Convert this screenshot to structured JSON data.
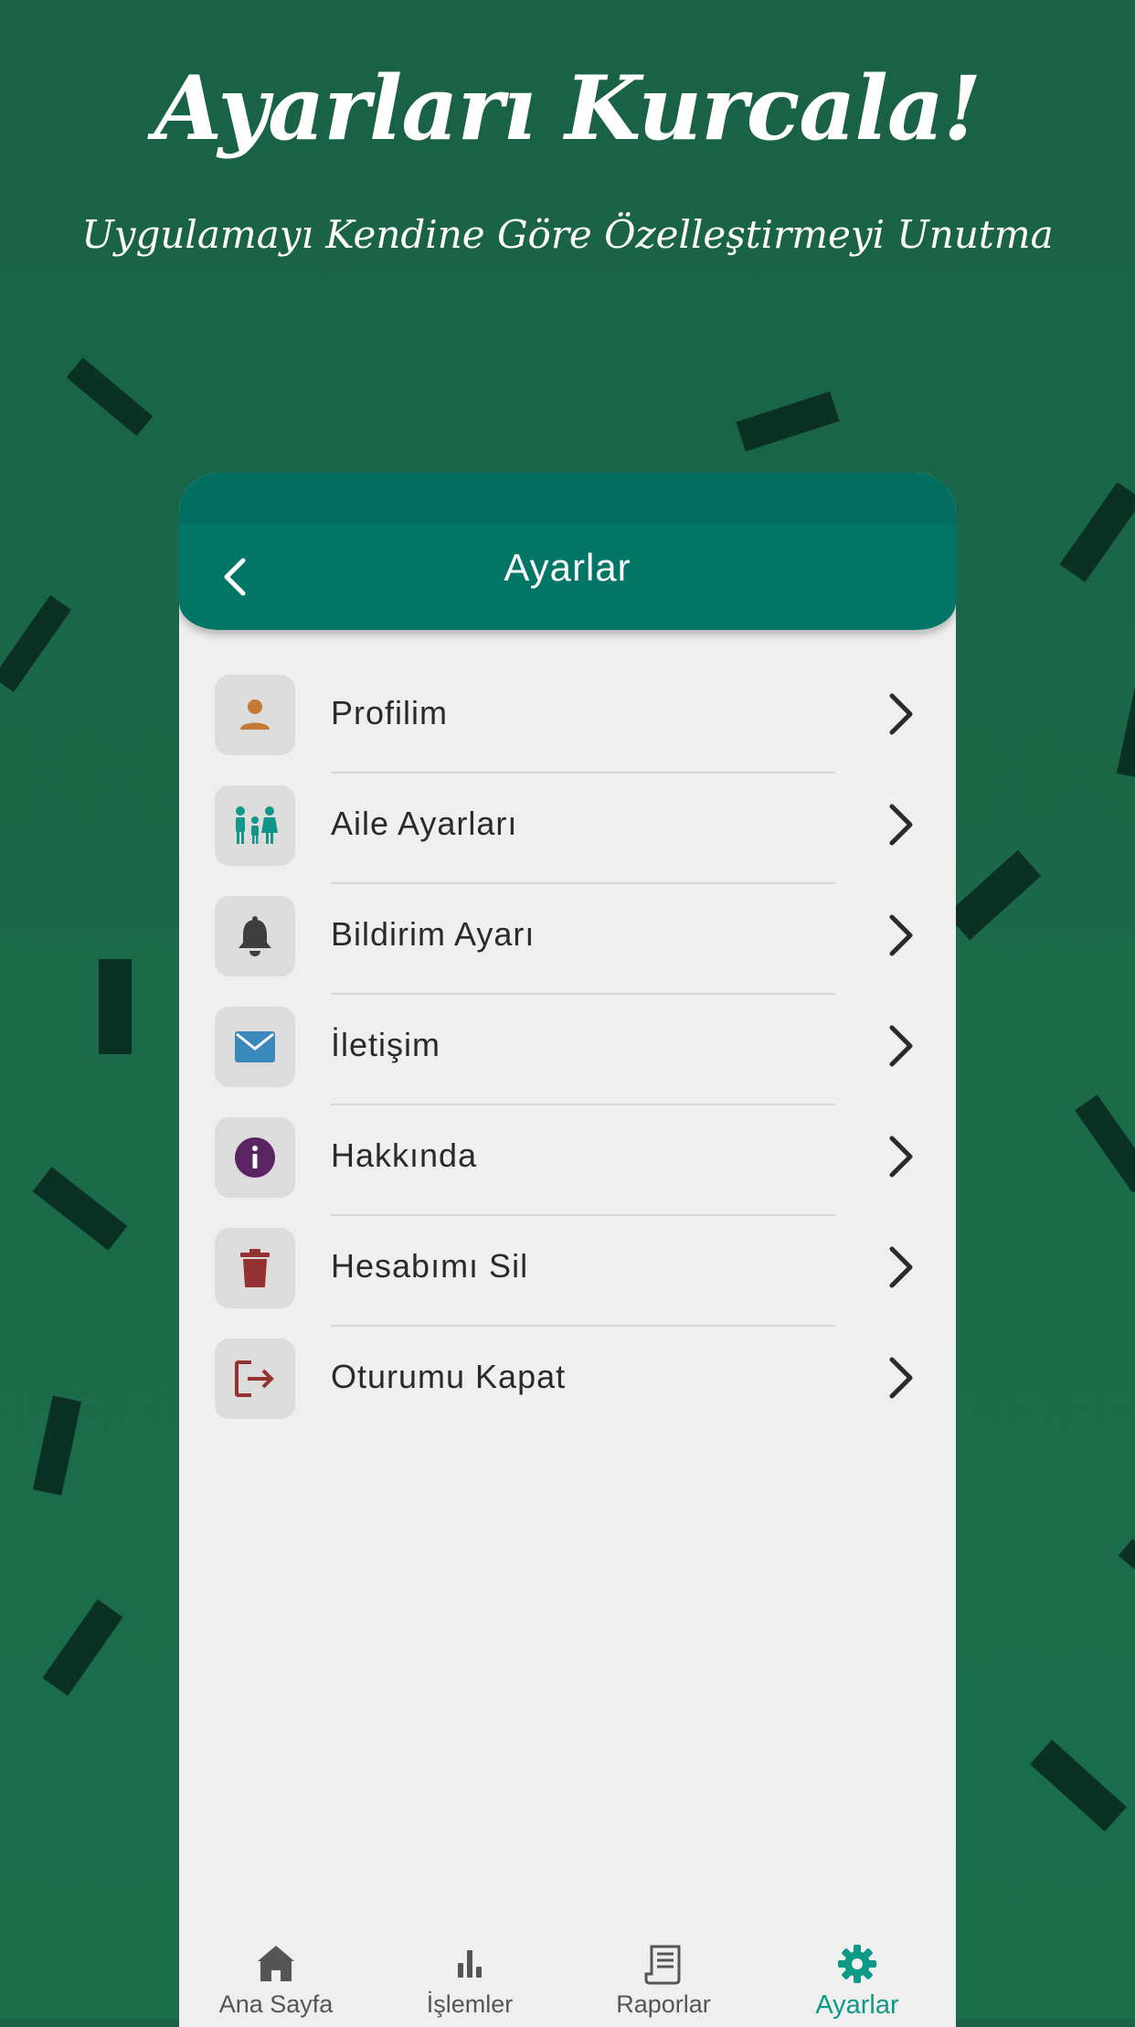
{
  "hero": {
    "title": "Ayarları Kurcala!",
    "subtitle": "Uygulamayı Kendine Göre Özelleştirmeyi Unutma"
  },
  "appbar": {
    "title": "Ayarlar",
    "back_icon": "chevron-left-icon"
  },
  "menu": {
    "items": [
      {
        "label": "Profilim",
        "icon": "person-icon",
        "icon_color": "#c57a33"
      },
      {
        "label": "Aile Ayarları",
        "icon": "family-icon",
        "icon_color": "#11968a"
      },
      {
        "label": "Bildirim Ayarı",
        "icon": "bell-icon",
        "icon_color": "#3d3d3d"
      },
      {
        "label": "İletişim",
        "icon": "mail-icon",
        "icon_color": "#3b88bd"
      },
      {
        "label": "Hakkında",
        "icon": "info-icon",
        "icon_color": "#5a2463"
      },
      {
        "label": "Hesabımı Sil",
        "icon": "trash-icon",
        "icon_color": "#943232"
      },
      {
        "label": "Oturumu Kapat",
        "icon": "logout-icon",
        "icon_color": "#943232"
      }
    ],
    "chevron_icon": "chevron-right-icon"
  },
  "tabbar": {
    "tabs": [
      {
        "label": "Ana Sayfa",
        "icon": "home-icon"
      },
      {
        "label": "İşlemler",
        "icon": "bar-chart-icon"
      },
      {
        "label": "Raporlar",
        "icon": "receipt-icon"
      },
      {
        "label": "Ayarlar",
        "icon": "gear-icon",
        "active": true
      }
    ]
  },
  "colors": {
    "background": "#1b6a4a",
    "appbar": "#017666",
    "accent": "#0c9a86",
    "confetti": "#0b3024"
  }
}
